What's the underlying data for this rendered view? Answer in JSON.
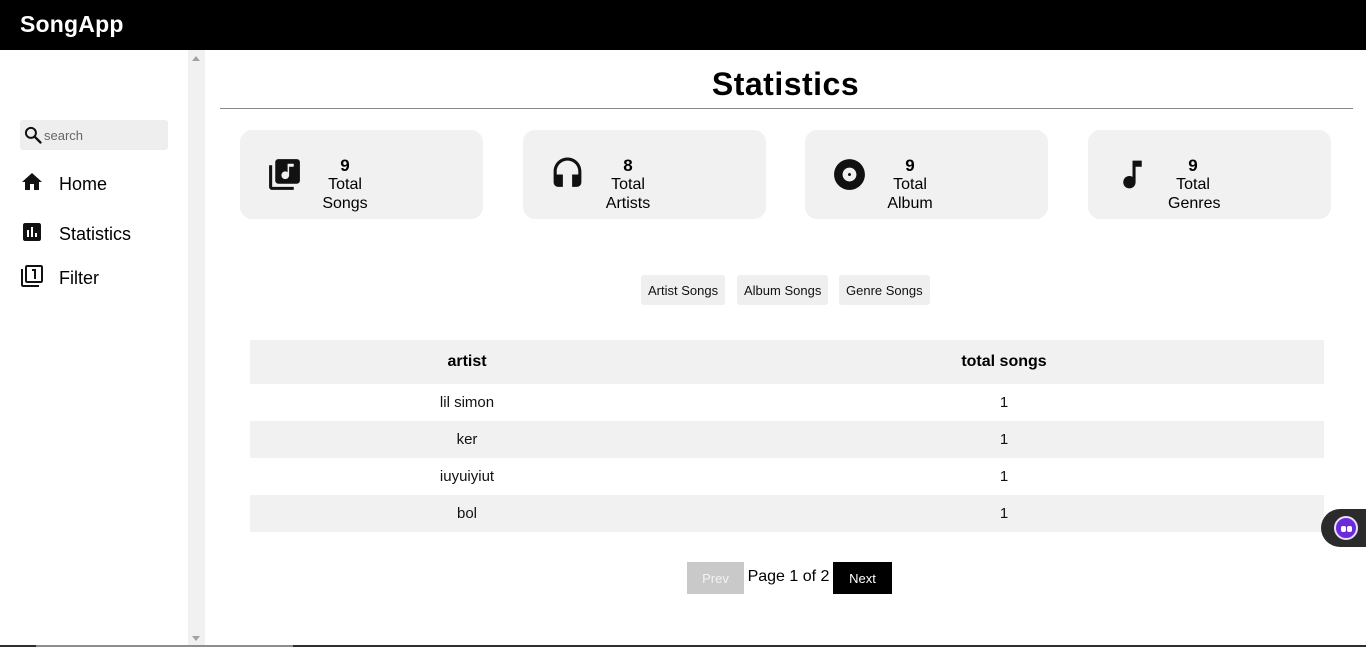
{
  "app": {
    "brand": "SongApp"
  },
  "sidebar": {
    "search_placeholder": "search",
    "items": [
      {
        "label": "Home",
        "icon": "home-icon"
      },
      {
        "label": "Statistics",
        "icon": "bar-chart-icon"
      },
      {
        "label": "Filter",
        "icon": "filter-one-icon"
      }
    ]
  },
  "page": {
    "title": "Statistics"
  },
  "cards": [
    {
      "value": "9",
      "line1": "Total",
      "line2": "Songs",
      "icon": "library-music-icon"
    },
    {
      "value": "8",
      "line1": "Total",
      "line2": "Artists",
      "icon": "headphones-icon"
    },
    {
      "value": "9",
      "line1": "Total",
      "line2": "Album",
      "icon": "album-disc-icon"
    },
    {
      "value": "9",
      "line1": "Total",
      "line2": "Genres",
      "icon": "music-note-icon"
    }
  ],
  "tabs": [
    "Artist Songs",
    "Album Songs",
    "Genre Songs"
  ],
  "table": {
    "headers": [
      "artist",
      "total songs"
    ],
    "rows": [
      [
        "lil simon",
        "1"
      ],
      [
        "ker",
        "1"
      ],
      [
        "iuyuiyiut",
        "1"
      ],
      [
        "bol",
        "1"
      ]
    ]
  },
  "pagination": {
    "prev": "Prev",
    "info": "Page 1 of 2",
    "next": "Next"
  },
  "colors": {
    "topbar": "#000000",
    "card_bg": "#f1f1f1",
    "accent": "#6c2bd9"
  }
}
